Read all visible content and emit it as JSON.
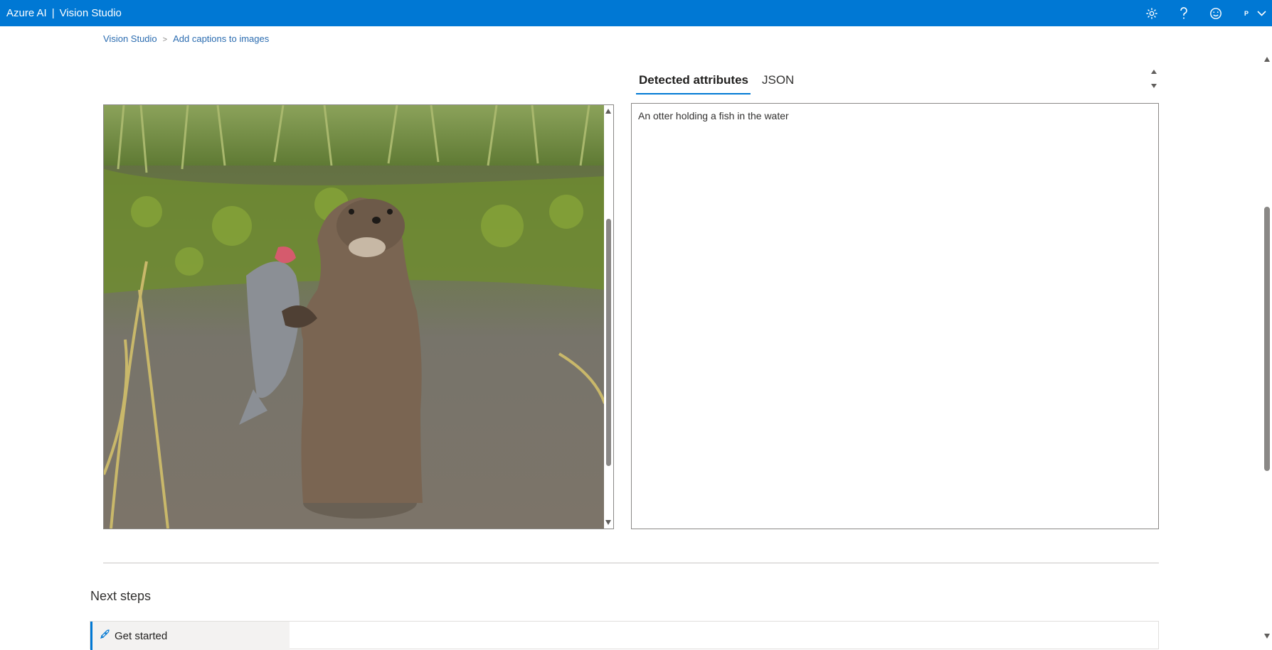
{
  "header": {
    "brand_left": "Azure AI",
    "brand_separator": "|",
    "brand_right": "Vision Studio",
    "icons": [
      "gear-icon",
      "help-icon",
      "feedback-smiley-icon",
      "user-avatar",
      "chevron-down-icon"
    ],
    "user_initial": "P",
    "color": "#0078d4"
  },
  "breadcrumb": {
    "items": [
      "Vision Studio",
      "Add captions to images"
    ]
  },
  "tabs": {
    "items": [
      "Detected attributes",
      "JSON"
    ],
    "active": "Detected attributes"
  },
  "result": {
    "caption": "An otter holding a fish in the water"
  },
  "next_steps": {
    "title": "Next steps",
    "items": [
      "Get started"
    ]
  },
  "colors": {
    "accent": "#0078d4",
    "border": "#8a8886"
  }
}
